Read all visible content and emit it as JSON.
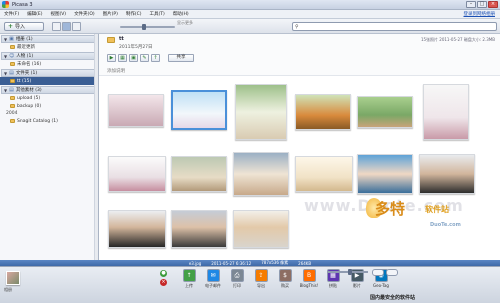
{
  "window": {
    "title": "Picasa 3",
    "buttons": {
      "min": "–",
      "max": "□",
      "close": "×"
    }
  },
  "menu": {
    "items": [
      "文件(F)",
      "编辑(E)",
      "视图(V)",
      "文件夹(O)",
      "图片(P)",
      "制作(C)",
      "工具(T)",
      "帮助(H)"
    ],
    "signin": "登录到网络相册"
  },
  "toolbar": {
    "import_label": "导入",
    "slider_caption": "显示更多",
    "search_placeholder": ""
  },
  "sidebar": {
    "groups": [
      {
        "label": "相册 (1)",
        "icon": "album-icon"
      },
      {
        "label": "人物 (1)",
        "icon": "people-icon"
      },
      {
        "label": "文件夹 (1)",
        "icon": "folder-icon"
      },
      {
        "label": "其他素材 (3)",
        "icon": "folder-icon"
      }
    ],
    "items": {
      "recent": "最近更新",
      "unnamed": "未命名 (16)",
      "folder_selected": "tt (15)",
      "upload": "upload (5)",
      "backup": "backup (0)",
      "snagit": "Snagit Catalog (1)"
    },
    "year": "2004"
  },
  "content": {
    "folder_name": "tt",
    "date": "2011年5月27日",
    "side_info": "15张照片 2011-05-27 \n 磁盘大小: 2.3MB",
    "share_label": "共享",
    "description": "添加说明"
  },
  "watermark": "www.Duote.com",
  "logo": {
    "big": "多特",
    "small": "软件站",
    "url": "DuoTe.com"
  },
  "statusbar": {
    "file": "e3.jpg",
    "datetime": "2011-05-27 6:36:12",
    "dims": "787x536 像素",
    "size": "264KB"
  },
  "tray": {
    "label": "相册",
    "tools": [
      {
        "label": "上传",
        "color": "#43a047",
        "glyph": "↑"
      },
      {
        "label": "电子邮件",
        "color": "#1e88e5",
        "glyph": "✉"
      },
      {
        "label": "打印",
        "color": "#7b8794",
        "glyph": "⎙"
      },
      {
        "label": "导出",
        "color": "#f57c00",
        "glyph": "⇪"
      },
      {
        "label": "购买",
        "color": "#8d6e63",
        "glyph": "$"
      },
      {
        "label": "BlogThis!",
        "color": "#ff6d00",
        "glyph": "B"
      },
      {
        "label": "拼贴",
        "color": "#5e35b1",
        "glyph": "▦"
      },
      {
        "label": "影片",
        "color": "#455a64",
        "glyph": "▶"
      },
      {
        "label": "Geo-Tag",
        "color": "#0277bd",
        "glyph": "◉"
      }
    ],
    "footer": "国内最安全的软件站"
  }
}
